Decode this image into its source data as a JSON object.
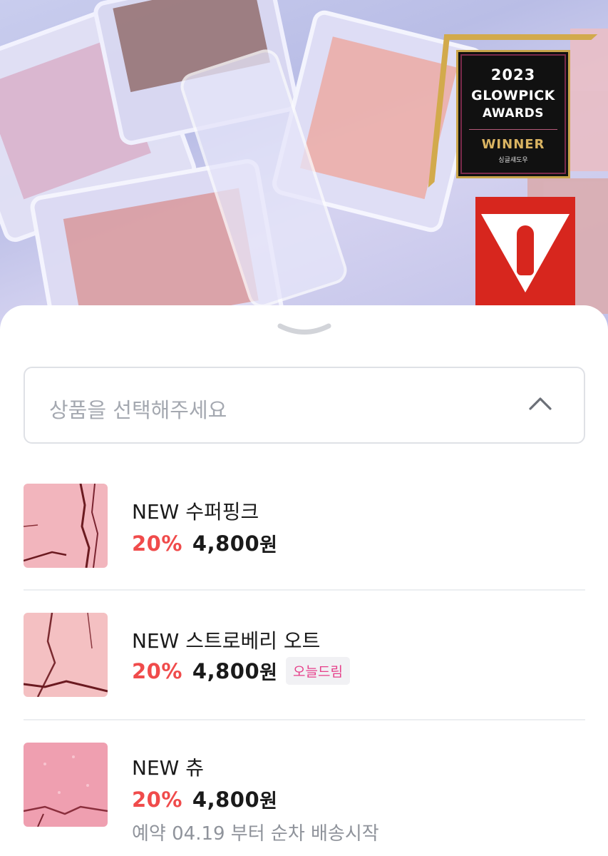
{
  "hero": {
    "award": {
      "year": "2023",
      "line2": "GLOWPICK",
      "line3": "AWARDS",
      "winner": "WINNER",
      "sub": "싱글섀도우"
    }
  },
  "sheet": {
    "select_placeholder": "상품을 선택해주세요"
  },
  "products": [
    {
      "name": "NEW 수퍼핑크",
      "discount": "20%",
      "price": "4,800",
      "unit": "원",
      "badge": "",
      "note": ""
    },
    {
      "name": "NEW 스트로베리 오트",
      "discount": "20%",
      "price": "4,800",
      "unit": "원",
      "badge": "오늘드림",
      "note": ""
    },
    {
      "name": "NEW 츄",
      "discount": "20%",
      "price": "4,800",
      "unit": "원",
      "badge": "",
      "note": "예약 04.19 부터 순차 배송시작"
    }
  ],
  "colors": {
    "discount": "#f04b4b",
    "badge_text": "#e6408a",
    "swatch_1": "#f2b5bd",
    "swatch_2": "#f4c0c2",
    "swatch_3": "#ef9fb0"
  }
}
